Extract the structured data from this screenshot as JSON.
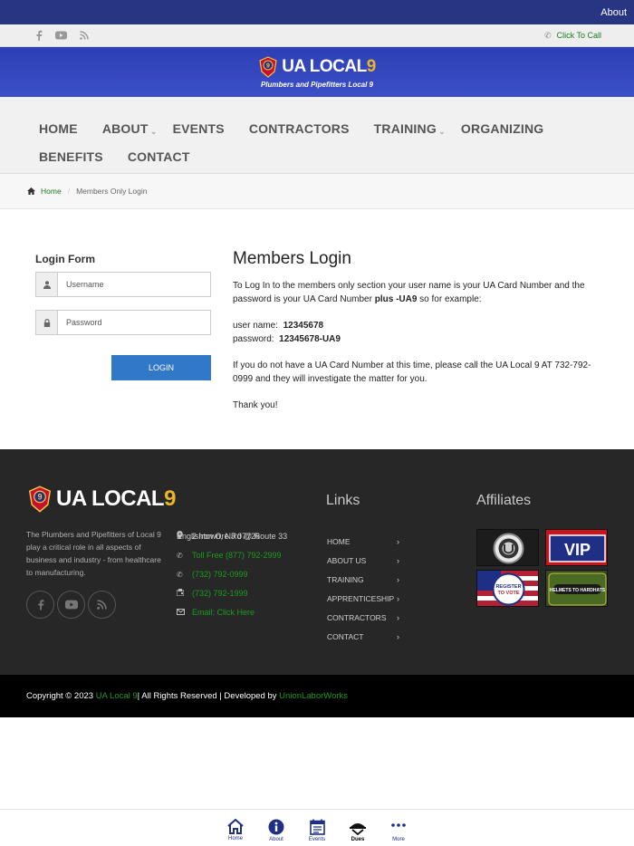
{
  "topbar": {
    "about": "About"
  },
  "socialbar": {
    "call_label": "Click To Call"
  },
  "banner": {
    "logo_ua": "UA LOCAL",
    "logo_nine": "9",
    "tagline": "Plumbers and Pipefitters Local 9"
  },
  "nav": {
    "row1": [
      "HOME",
      "ABOUT",
      "EVENTS",
      "CONTRACTORS",
      "TRAINING",
      "ORGANIZING"
    ],
    "row2": [
      "BENEFITS",
      "CONTACT"
    ]
  },
  "breadcrumb": {
    "home": "Home",
    "current": "Members Only Login"
  },
  "login": {
    "title": "Login Form",
    "username_placeholder": "Username",
    "password_placeholder": "Password",
    "button": "LOGIN"
  },
  "content": {
    "heading": "Members Login",
    "intro_a": "To Log In to the members only section your user name is your UA Card Number and the password is your UA Card Number ",
    "intro_b": "plus -UA9",
    "intro_c": " so for example:",
    "username_label": "user name:",
    "username_value": "12345678",
    "password_label": "password:",
    "password_value": "12345678-UA9",
    "no_card": "If you do not have a UA Card Number at this time, please call the UA Local 9 AT 732-792-0999 and they will investigate the matter for you.",
    "thanks": "Thank you!"
  },
  "footer": {
    "logo_ua": "UA LOCAL",
    "logo_nine": "9",
    "about": "The Plumbers and Pipefitters of Local 9 play a critical role in all aspects of business and industry - from healthcare to manufacturing.",
    "address_line1": "2 Iron Ore Rd @ Route 33",
    "address_line2": "Englishtown, NJ 07726",
    "toll_free": "Toll Free (877) 792-2999",
    "phone": "(732) 792-0999",
    "fax": "(732) 792-1999",
    "email": "Email: Click Here",
    "links_title": "Links",
    "links": [
      "HOME",
      "ABOUT US",
      "TRAINING",
      "APPRENTICESHIP",
      "CONTRACTORS",
      "CONTACT"
    ],
    "affiliates_title": "Affiliates",
    "affiliates": [
      {
        "name": "ua-seal"
      },
      {
        "name": "vip",
        "text": "VIP"
      },
      {
        "name": "register-to-vote",
        "text": "REGISTER TO VOTE"
      },
      {
        "name": "helmets-to-hardhats",
        "text": "HELMETS TO HARDHATS"
      }
    ]
  },
  "copyright": {
    "prefix": "Copyright © 2023 ",
    "org": "UA Local 9",
    "middle": " | All Rights Reserved | Developed by ",
    "dev": "UnionLaborWorks"
  },
  "bottom_nav": [
    {
      "label": "Home",
      "icon": "home-icon"
    },
    {
      "label": "About",
      "icon": "info-icon"
    },
    {
      "label": "Events",
      "icon": "calendar-icon"
    },
    {
      "label": "Dues",
      "icon": "dues-icon"
    },
    {
      "label": "More",
      "icon": "more-icon"
    }
  ],
  "colors": {
    "brand_blue": "#273583",
    "banner_blue": "#3446be",
    "link_green": "#1d9a1d",
    "button_blue": "#3278c8"
  }
}
